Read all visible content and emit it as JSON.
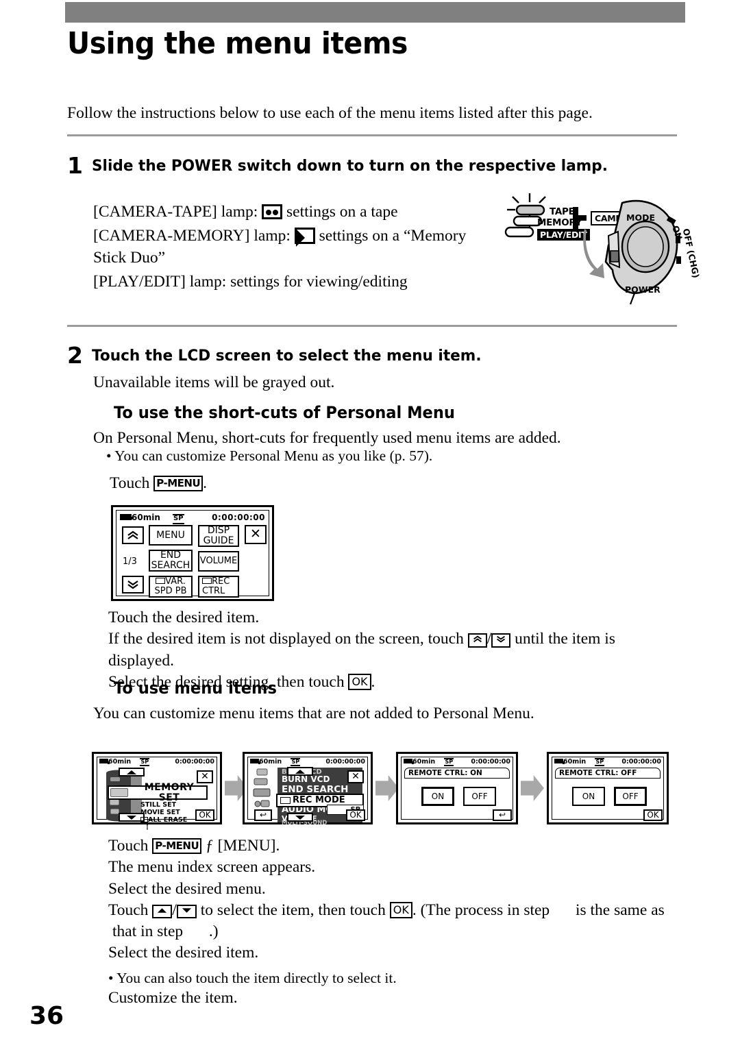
{
  "page": {
    "title": "Using the menu items",
    "intro": "Follow the instructions below to use each of the menu items listed after this page.",
    "page_number": "36"
  },
  "step1": {
    "number": "1",
    "heading": "Slide the POWER switch down to turn on the respective lamp.",
    "lines": {
      "camera_tape_pre": "[CAMERA-TAPE] lamp:",
      "camera_tape_post": "settings on a tape",
      "camera_memory_pre": "[CAMERA-MEMORY] lamp:",
      "camera_memory_post": "settings on a “Memory",
      "camera_memory_cont": "Stick Duo”",
      "play_edit": "[PLAY/EDIT] lamp: settings for viewing/editing"
    }
  },
  "power_switch": {
    "lamp_labels": [
      "TAPE",
      "MEMORY",
      "PLAY/EDIT"
    ],
    "camera_tag": "CAMERA",
    "dial_labels": [
      "MODE",
      "ON",
      "OFF (CHG)",
      "POWER"
    ]
  },
  "step2": {
    "number": "2",
    "heading": "Touch the LCD screen to select the menu item.",
    "note": "Unavailable items will be grayed out."
  },
  "shortcuts_section": {
    "heading": "To use the short-cuts of Personal Menu",
    "line1": "On Personal Menu, short-cuts for frequently used menu items are added.",
    "bullet1": "• You can customize Personal Menu as you like (p. 57).",
    "touch_pre": "Touch",
    "pmenu_label": "P-MENU",
    "touch_post": ".",
    "after_lines": {
      "l1": "Touch the desired item.",
      "l2a": "If the desired item is not displayed on the screen, touch",
      "l2b": "until the item is displayed.",
      "l3a": "Select the desired setting, then touch",
      "l3b": "."
    }
  },
  "pmenu_screen": {
    "status": {
      "battery": "60min",
      "mode_badge": "SP",
      "timecode": "0:00:00:00"
    },
    "page_indicator": "1/3",
    "up_arrow": "❯",
    "down_arrow": "❯",
    "close": "✕",
    "buttons": [
      {
        "label": "MENU"
      },
      {
        "label": "DISP\nGUIDE"
      },
      {
        "label": "END\nSEARCH"
      },
      {
        "label": "VOLUME"
      },
      {
        "label": "VAR.\nSPD PB",
        "icon": "tape-icon"
      },
      {
        "label": "REC\nCTRL",
        "icon": "tape-icon"
      }
    ]
  },
  "menu_items_section": {
    "heading": "To use menu items",
    "line1": "You can customize menu items that are not added to Personal Menu."
  },
  "sequence": {
    "screen1": {
      "status": {
        "battery": "60min",
        "mode_badge": "SP",
        "timecode": "0:00:00:00"
      },
      "selected_title": "MEMORY SET",
      "sub_items": [
        "STILL  SET",
        "MOVIE  SET",
        "ALL  ERASE",
        "⋮"
      ],
      "close": "✕",
      "ok": "OK"
    },
    "screen2": {
      "status": {
        "battery": "60min",
        "mode_badge": "SP",
        "timecode": "0:00:00:00"
      },
      "items": [
        "BURN VCD",
        "END SEARCH",
        "REC MODE",
        "AUDIO MODE",
        "VOLUME",
        "MULTI-SOUND"
      ],
      "selected": "REC MODE",
      "selected_value": "SP",
      "close": "✕",
      "ok": "OK",
      "back": "↩"
    },
    "screen3": {
      "status": {
        "battery": "60min",
        "mode_badge": "SP",
        "timecode": "0:00:00:00"
      },
      "title": "REMOTE CTRL:  ON",
      "options": [
        "ON",
        "OFF"
      ],
      "selected": "ON",
      "back": "↩"
    },
    "screen4": {
      "status": {
        "battery": "60min",
        "mode_badge": "SP",
        "timecode": "0:00:00:00"
      },
      "title": "REMOTE CTRL:  OFF",
      "options": [
        "ON",
        "OFF"
      ],
      "selected": "OFF",
      "ok": "OK"
    }
  },
  "footer_steps": {
    "l1a": "Touch",
    "l1_pmenu": "P-MENU",
    "l1b": "ƒ",
    "l1c": "[MENU].",
    "l2": "The menu index screen appears.",
    "l3": "Select the desired menu.",
    "l4a": "Touch",
    "l4b": "to select the item, then touch",
    "l4c": ". (The process in step",
    "l4d": "is the same as",
    "l4e": "that in step",
    "l4f": ".)",
    "l5": "Select the desired item.",
    "l6": "• You can also touch the item directly to select it.",
    "l7": "Customize the item."
  },
  "colors": {
    "band": "#808080",
    "rule": "#9b9b9b",
    "arrow": "#a8a8a8",
    "drum": "#3a3a3a"
  }
}
